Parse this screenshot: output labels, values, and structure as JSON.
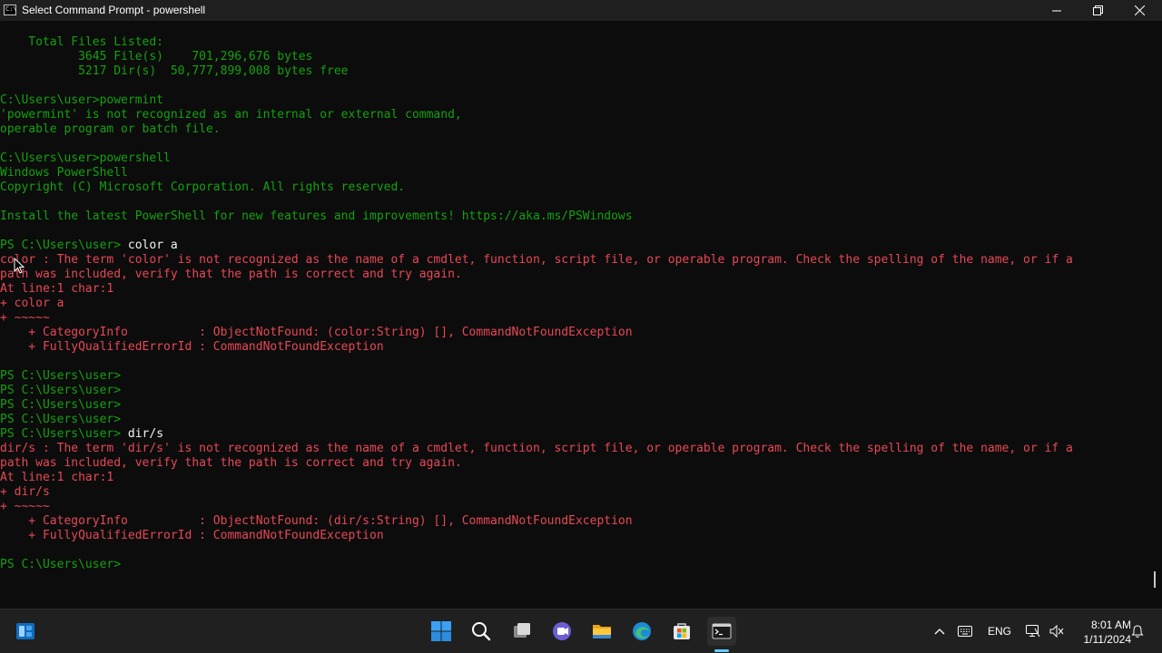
{
  "window": {
    "title": "Select Command Prompt - powershell",
    "app_icon_text": "C:\\"
  },
  "console": {
    "lines": [
      {
        "prompt": "    Total Files Listed:",
        "cmd": "",
        "style": "out"
      },
      {
        "prompt": "           3645 File(s)    701,296,676 bytes",
        "cmd": "",
        "style": "out"
      },
      {
        "prompt": "           5217 Dir(s)  50,777,899,008 bytes free",
        "cmd": "",
        "style": "out"
      },
      {
        "prompt": "",
        "cmd": "",
        "style": "out"
      },
      {
        "prompt": "C:\\Users\\user>powermint",
        "cmd": "",
        "style": "out"
      },
      {
        "prompt": "'powermint' is not recognized as an internal or external command,",
        "cmd": "",
        "style": "out"
      },
      {
        "prompt": "operable program or batch file.",
        "cmd": "",
        "style": "out"
      },
      {
        "prompt": "",
        "cmd": "",
        "style": "out"
      },
      {
        "prompt": "C:\\Users\\user>powershell",
        "cmd": "",
        "style": "out"
      },
      {
        "prompt": "Windows PowerShell",
        "cmd": "",
        "style": "out"
      },
      {
        "prompt": "Copyright (C) Microsoft Corporation. All rights reserved.",
        "cmd": "",
        "style": "out"
      },
      {
        "prompt": "",
        "cmd": "",
        "style": "out"
      },
      {
        "prompt": "Install the latest PowerShell for new features and improvements! https://aka.ms/PSWindows",
        "cmd": "",
        "style": "out"
      },
      {
        "prompt": "",
        "cmd": "",
        "style": "out"
      },
      {
        "prompt": "PS C:\\Users\\user> ",
        "cmd": "color a",
        "style": "out"
      },
      {
        "prompt": "color : The term 'color' is not recognized as the name of a cmdlet, function, script file, or operable program. Check the spelling of the name, or if a",
        "cmd": "",
        "style": "err"
      },
      {
        "prompt": "path was included, verify that the path is correct and try again.",
        "cmd": "",
        "style": "err"
      },
      {
        "prompt": "At line:1 char:1",
        "cmd": "",
        "style": "err"
      },
      {
        "prompt": "+ color a",
        "cmd": "",
        "style": "err"
      },
      {
        "prompt": "+ ~~~~~",
        "cmd": "",
        "style": "err"
      },
      {
        "prompt": "    + CategoryInfo          : ObjectNotFound: (color:String) [], CommandNotFoundException",
        "cmd": "",
        "style": "err"
      },
      {
        "prompt": "    + FullyQualifiedErrorId : CommandNotFoundException",
        "cmd": "",
        "style": "err"
      },
      {
        "prompt": "",
        "cmd": "",
        "style": "out"
      },
      {
        "prompt": "PS C:\\Users\\user>",
        "cmd": "",
        "style": "out"
      },
      {
        "prompt": "PS C:\\Users\\user>",
        "cmd": "",
        "style": "out"
      },
      {
        "prompt": "PS C:\\Users\\user>",
        "cmd": "",
        "style": "out"
      },
      {
        "prompt": "PS C:\\Users\\user>",
        "cmd": "",
        "style": "out"
      },
      {
        "prompt": "PS C:\\Users\\user> ",
        "cmd": "dir/s",
        "style": "out"
      },
      {
        "prompt": "dir/s : The term 'dir/s' is not recognized as the name of a cmdlet, function, script file, or operable program. Check the spelling of the name, or if a",
        "cmd": "",
        "style": "err"
      },
      {
        "prompt": "path was included, verify that the path is correct and try again.",
        "cmd": "",
        "style": "err"
      },
      {
        "prompt": "At line:1 char:1",
        "cmd": "",
        "style": "err"
      },
      {
        "prompt": "+ dir/s",
        "cmd": "",
        "style": "err"
      },
      {
        "prompt": "+ ~~~~~",
        "cmd": "",
        "style": "err"
      },
      {
        "prompt": "    + CategoryInfo          : ObjectNotFound: (dir/s:String) [], CommandNotFoundException",
        "cmd": "",
        "style": "err"
      },
      {
        "prompt": "    + FullyQualifiedErrorId : CommandNotFoundException",
        "cmd": "",
        "style": "err"
      },
      {
        "prompt": "",
        "cmd": "",
        "style": "out"
      },
      {
        "prompt": "PS C:\\Users\\user>",
        "cmd": "",
        "style": "out"
      }
    ]
  },
  "taskbar": {
    "apps": [
      "start-icon",
      "search-icon",
      "task-view-icon",
      "teams-chat-icon",
      "file-explorer-icon",
      "edge-icon",
      "microsoft-store-icon",
      "terminal-icon"
    ],
    "active_app": "terminal-icon"
  },
  "tray": {
    "language": "ENG",
    "time": "8:01 AM",
    "date": "1/11/2024"
  },
  "colors": {
    "console_bg": "#0c0c0c",
    "output_text": "#13a10e",
    "error_text": "#e74856",
    "command_text": "#f2f2f2",
    "titlebar_bg": "#1f1f1f",
    "taskbar_bg": "#202020",
    "accent": "#60cdff"
  }
}
